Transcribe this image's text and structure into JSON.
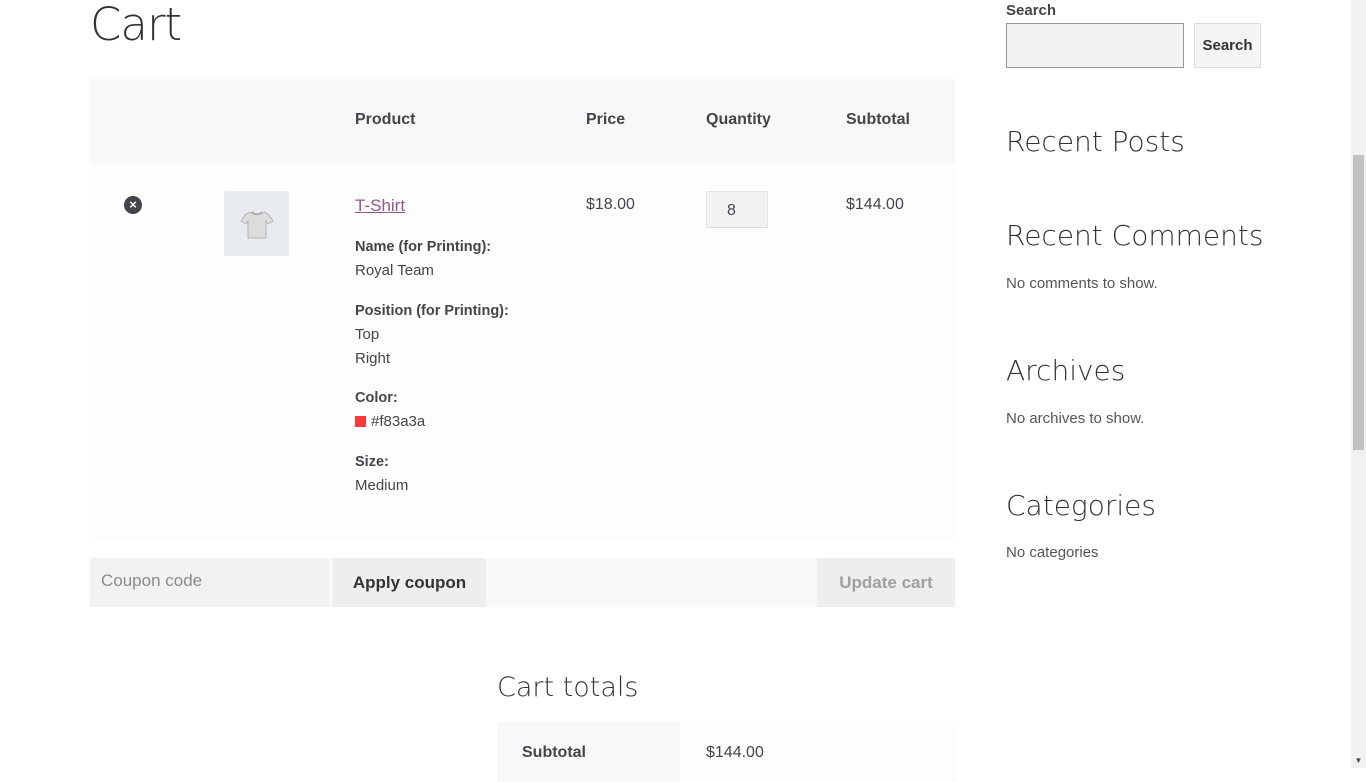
{
  "page": {
    "title": "Cart"
  },
  "cart": {
    "headers": {
      "product": "Product",
      "price": "Price",
      "quantity": "Quantity",
      "subtotal": "Subtotal"
    },
    "item": {
      "remove_icon": "close-circle-icon",
      "name": "T-Shirt",
      "price": "$18.00",
      "quantity": "8",
      "subtotal": "$144.00",
      "meta": [
        {
          "label": "Name (for Printing):",
          "values": [
            "Royal Team"
          ]
        },
        {
          "label": "Position (for Printing):",
          "values": [
            "Top",
            "Right"
          ]
        },
        {
          "label": "Color:",
          "values": [
            "#f83a3a"
          ],
          "swatch": "#f83a3a"
        },
        {
          "label": "Size:",
          "values": [
            "Medium"
          ]
        }
      ]
    },
    "coupon_placeholder": "Coupon code",
    "apply_coupon": "Apply coupon",
    "update_cart": "Update cart"
  },
  "totals": {
    "title": "Cart totals",
    "subtotal_label": "Subtotal",
    "subtotal_value": "$144.00"
  },
  "sidebar": {
    "search_label": "Search",
    "search_button": "Search",
    "recent_posts": "Recent Posts",
    "recent_comments": "Recent Comments",
    "no_comments": "No comments to show.",
    "archives": "Archives",
    "no_archives": "No archives to show.",
    "categories": "Categories",
    "no_categories": "No categories"
  },
  "colors": {
    "link": "#96588a",
    "swatch": "#f83a3a"
  }
}
